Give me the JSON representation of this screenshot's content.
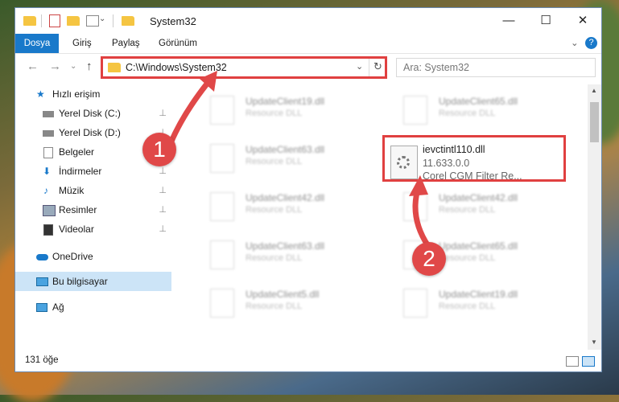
{
  "window": {
    "title": "System32",
    "minimize": "—",
    "maximize": "☐",
    "close": "✕"
  },
  "ribbon": {
    "tabs": [
      "Dosya",
      "Giriş",
      "Paylaş",
      "Görünüm"
    ],
    "chevron": "⌄",
    "help": "?"
  },
  "nav": {
    "back": "←",
    "forward": "→",
    "recent": "⌄",
    "up": "↑",
    "address": "C:\\Windows\\System32",
    "dropdown": "⌄",
    "refresh": "↻",
    "search_placeholder": "Ara: System32",
    "search_icon": "⌕"
  },
  "sidebar": {
    "items": [
      {
        "label": "Hızlı erişim",
        "icon": "star-icon",
        "pinned": false
      },
      {
        "label": "Yerel Disk (C:)",
        "icon": "drive-icon",
        "pinned": true
      },
      {
        "label": "Yerel Disk (D:)",
        "icon": "drive-icon",
        "pinned": true
      },
      {
        "label": "Belgeler",
        "icon": "documents-icon",
        "pinned": true
      },
      {
        "label": "İndirmeler",
        "icon": "download-icon",
        "pinned": true
      },
      {
        "label": "Müzik",
        "icon": "music-icon",
        "pinned": true
      },
      {
        "label": "Resimler",
        "icon": "pictures-icon",
        "pinned": true
      },
      {
        "label": "Videolar",
        "icon": "videos-icon",
        "pinned": true
      },
      {
        "label": "OneDrive",
        "icon": "cloud-icon",
        "pinned": false
      },
      {
        "label": "Bu bilgisayar",
        "icon": "computer-icon",
        "pinned": false
      },
      {
        "label": "Ağ",
        "icon": "network-icon",
        "pinned": false
      }
    ],
    "pin_glyph": "📌"
  },
  "files": [
    {
      "name": "UpdateClient19.dll",
      "type": "Resource DLL"
    },
    {
      "name": "UpdateClient65.dll",
      "type": "Resource DLL"
    },
    {
      "name": "UpdateClient63.dll",
      "type": "Resource DLL"
    },
    {
      "name": "UpdateClient42.dll",
      "type": "Resource DLL"
    },
    {
      "name": "UpdateClient42.dll",
      "type": "Resource DLL"
    },
    {
      "name": "UpdateClient63.dll",
      "type": "Resource DLL"
    },
    {
      "name": "UpdateClient65.dll",
      "type": "Resource DLL"
    },
    {
      "name": "UpdateClient5.dll",
      "type": "Resource DLL"
    },
    {
      "name": "UpdateClient19.dll",
      "type": "Resource DLL"
    }
  ],
  "highlighted_file": {
    "name": "ievctintl110.dll",
    "version": "11.633.0.0",
    "description": "Corel CGM Filter Re..."
  },
  "status": {
    "count": "131 öğe"
  },
  "steps": {
    "one": "1",
    "two": "2"
  },
  "colors": {
    "accent": "#1979ca",
    "highlight_box": "#e04040",
    "badge": "#e04848",
    "selected": "#cce4f7"
  }
}
